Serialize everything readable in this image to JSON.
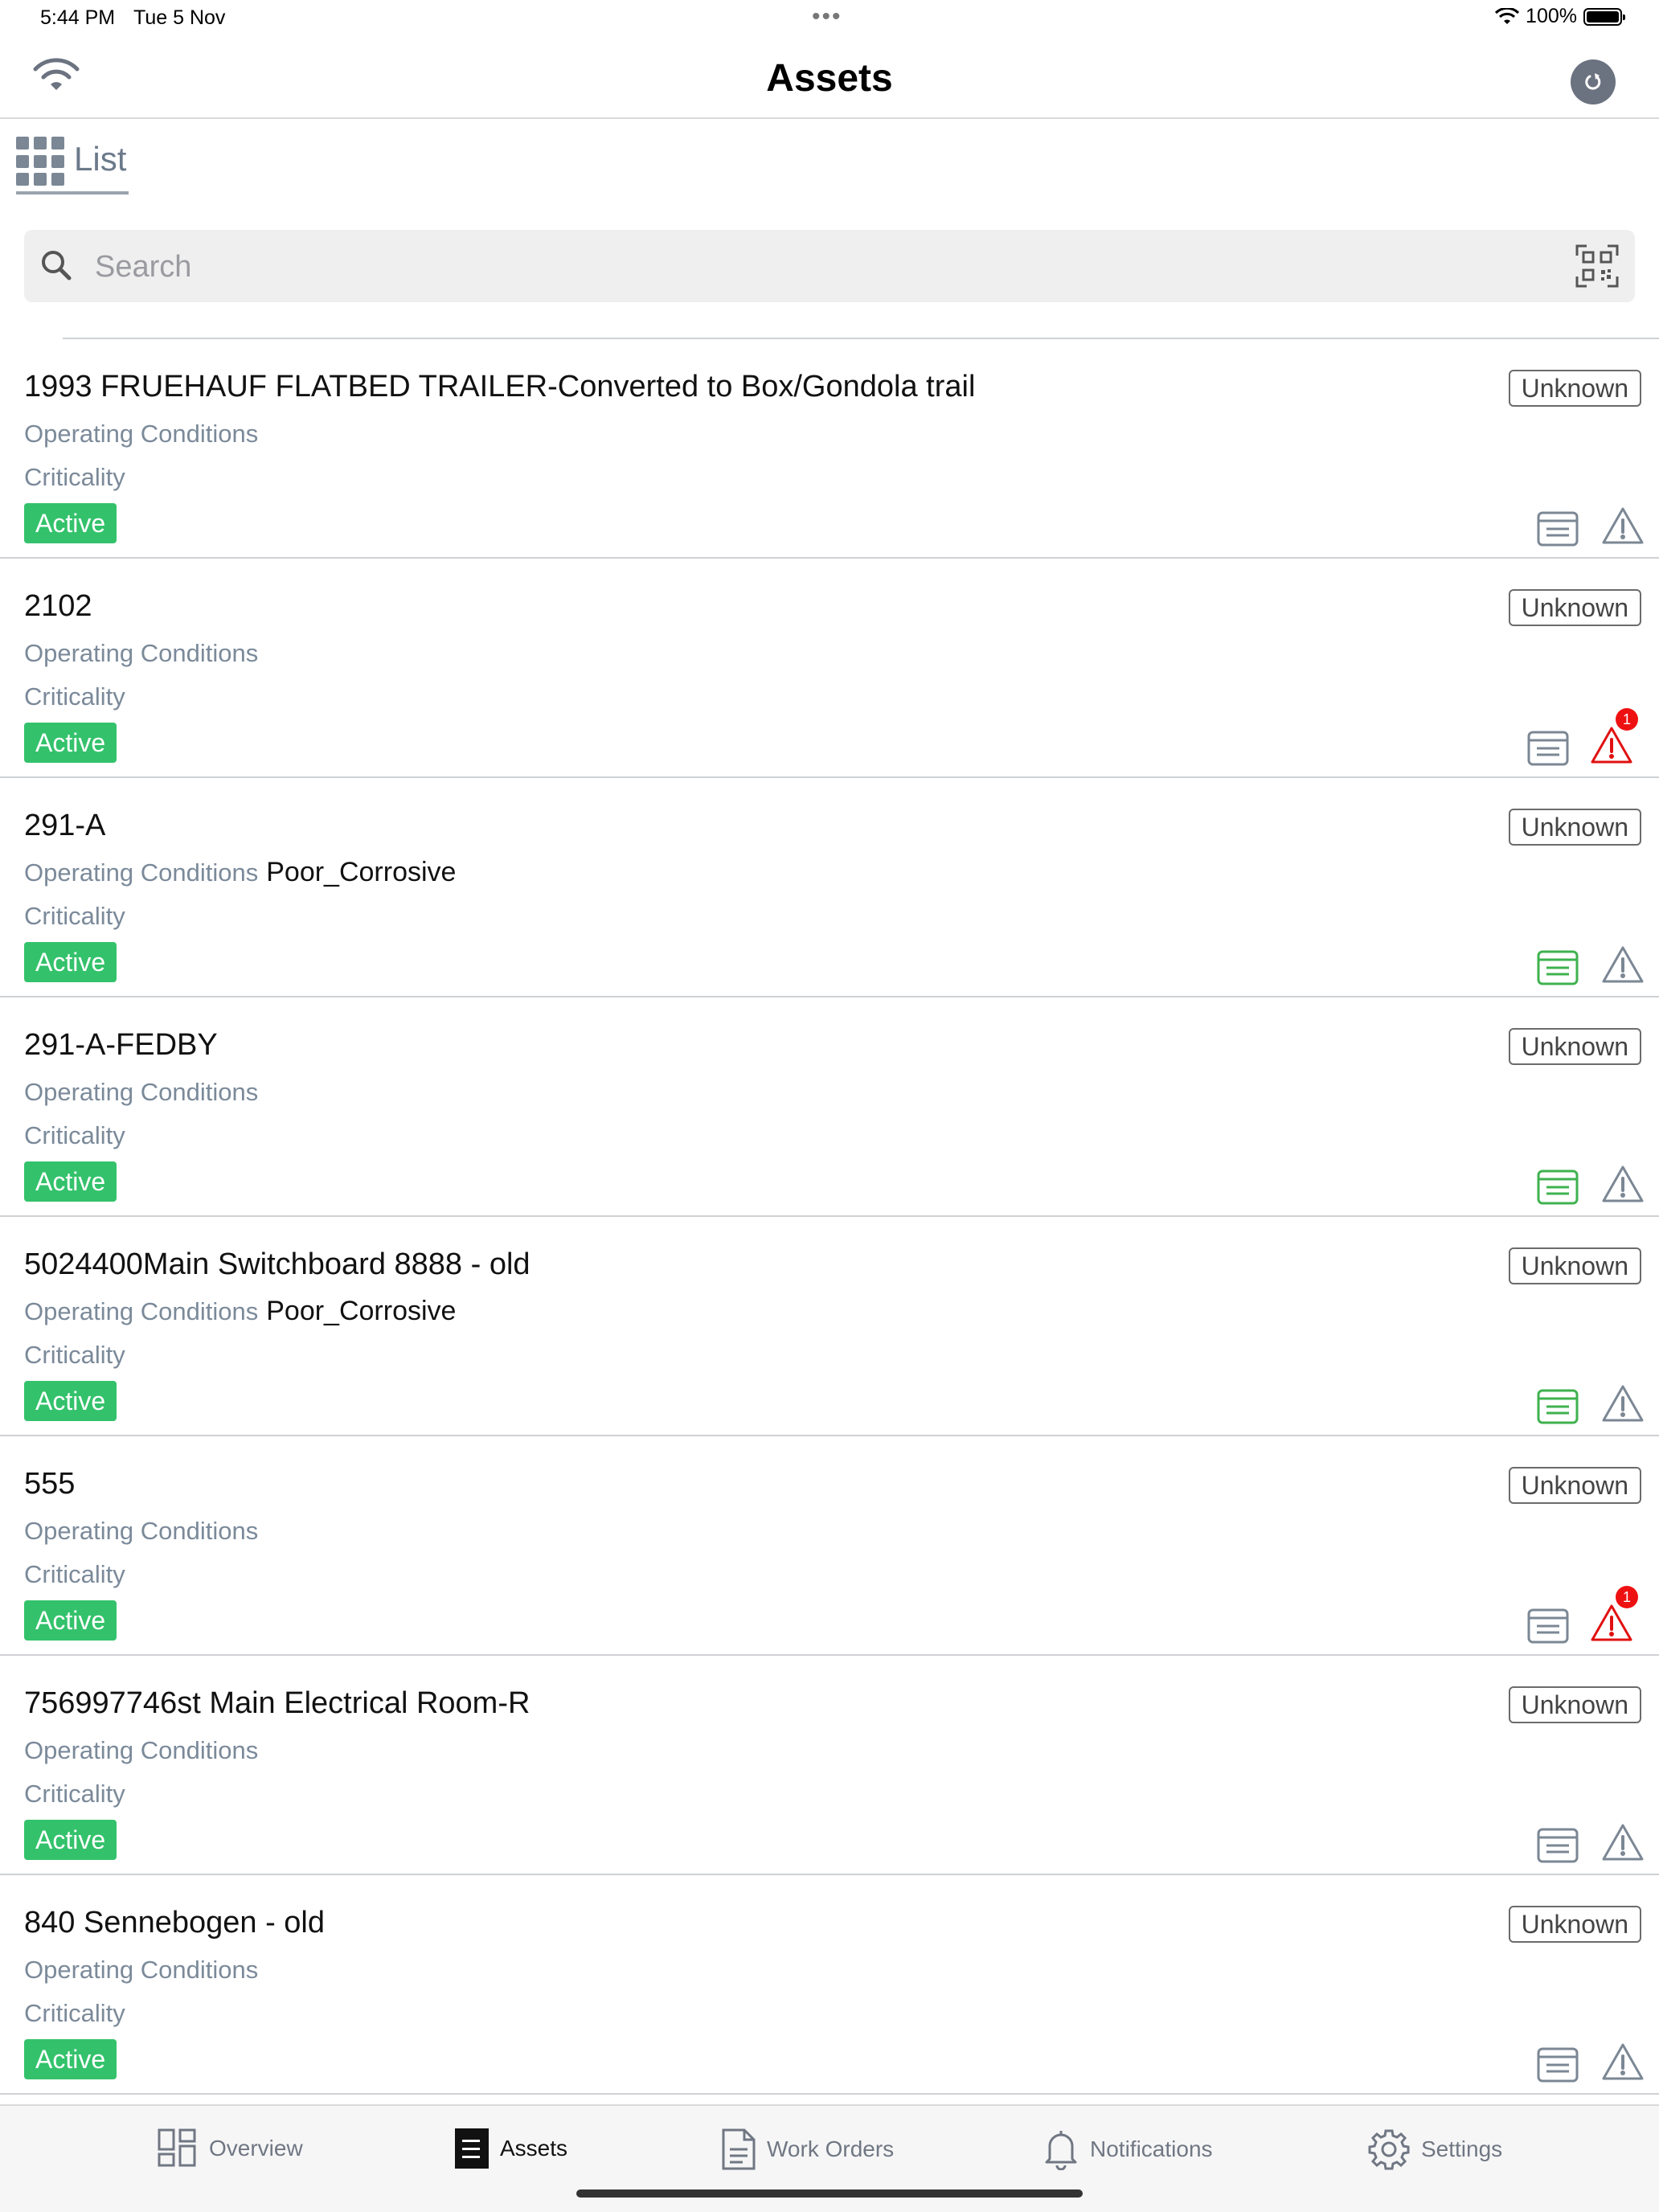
{
  "status_bar": {
    "time": "5:44 PM",
    "date": "Tue 5 Nov",
    "battery": "100%"
  },
  "header": {
    "title": "Assets"
  },
  "view_tab": {
    "label": "List"
  },
  "search": {
    "placeholder": "Search",
    "value": ""
  },
  "labels": {
    "operating_conditions": "Operating Conditions",
    "criticality": "Criticality"
  },
  "colors": {
    "active_green": "#33c26b",
    "alert_red": "#e11111",
    "icon_gray": "#7b8794",
    "form_green": "#3fb24f"
  },
  "assets": [
    {
      "name": "1993 FRUEHAUF FLATBED TRAILER-Converted to Box/Gondola trail",
      "operating_conditions": "",
      "criticality": "",
      "status": "Active",
      "condition": "Unknown",
      "form_icon": "gray",
      "alert_icon": "gray",
      "alert_count": ""
    },
    {
      "name": "2102",
      "operating_conditions": "",
      "criticality": "",
      "status": "Active",
      "condition": "Unknown",
      "form_icon": "gray",
      "alert_icon": "red",
      "alert_count": "1"
    },
    {
      "name": "291-A",
      "operating_conditions": "Poor_Corrosive",
      "criticality": "",
      "status": "Active",
      "condition": "Unknown",
      "form_icon": "green",
      "alert_icon": "gray",
      "alert_count": ""
    },
    {
      "name": "291-A-FEDBY",
      "operating_conditions": "",
      "criticality": "",
      "status": "Active",
      "condition": "Unknown",
      "form_icon": "green",
      "alert_icon": "gray",
      "alert_count": ""
    },
    {
      "name": "5024400Main Switchboard 8888 - old",
      "operating_conditions": "Poor_Corrosive",
      "criticality": "",
      "status": "Active",
      "condition": "Unknown",
      "form_icon": "green",
      "alert_icon": "gray",
      "alert_count": ""
    },
    {
      "name": "555",
      "operating_conditions": "",
      "criticality": "",
      "status": "Active",
      "condition": "Unknown",
      "form_icon": "gray",
      "alert_icon": "red",
      "alert_count": "1"
    },
    {
      "name": "756997746st Main Electrical Room-R",
      "operating_conditions": "",
      "criticality": "",
      "status": "Active",
      "condition": "Unknown",
      "form_icon": "gray",
      "alert_icon": "gray",
      "alert_count": ""
    },
    {
      "name": "840 Sennebogen - old",
      "operating_conditions": "",
      "criticality": "",
      "status": "Active",
      "condition": "Unknown",
      "form_icon": "gray",
      "alert_icon": "gray",
      "alert_count": ""
    }
  ],
  "tab_bar": {
    "items": [
      {
        "label": "Overview",
        "icon": "overview-icon"
      },
      {
        "label": "Assets",
        "icon": "assets-icon"
      },
      {
        "label": "Work Orders",
        "icon": "work-orders-icon"
      },
      {
        "label": "Notifications",
        "icon": "bell-icon"
      },
      {
        "label": "Settings",
        "icon": "gear-icon"
      }
    ],
    "selected": "Assets"
  }
}
